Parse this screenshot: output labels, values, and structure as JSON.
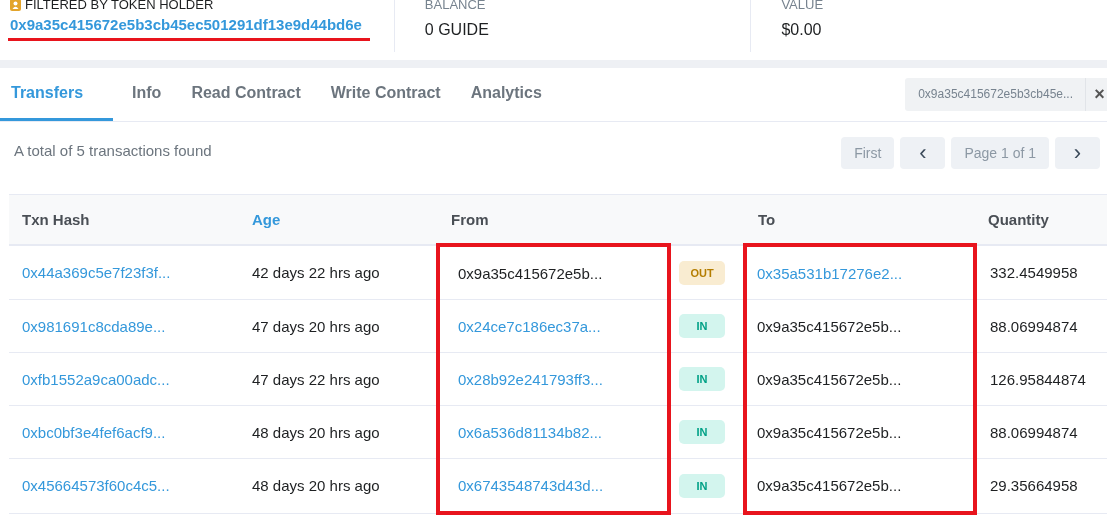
{
  "holder": {
    "label": "FILTERED BY TOKEN HOLDER",
    "address": "0x9a35c415672e5b3cb45ec501291df13e9d44bd6e",
    "underlined": true
  },
  "stats": [
    {
      "label": "BALANCE",
      "value": "0 GUIDE"
    },
    {
      "label": "VALUE",
      "value": "$0.00"
    }
  ],
  "tabs": [
    {
      "label": "Transfers",
      "selected": true
    },
    {
      "label": "Info",
      "selected": false
    },
    {
      "label": "Read Contract",
      "selected": false
    },
    {
      "label": "Write Contract",
      "selected": false
    },
    {
      "label": "Analytics",
      "selected": false
    }
  ],
  "filter_chip": {
    "value": "0x9a35c415672e5b3cb45e...",
    "close": "×"
  },
  "summary": "A total of 5 transactions found",
  "pagination": {
    "first": "First",
    "prev": "‹",
    "page": "Page 1 of 1",
    "next": "›"
  },
  "table": {
    "columns": [
      {
        "label": "Txn Hash",
        "sortable": false,
        "highlighted": false
      },
      {
        "label": "Age",
        "sortable": true,
        "highlighted": false
      },
      {
        "label": "From",
        "sortable": false,
        "highlighted": true
      },
      {
        "label": "To",
        "sortable": false,
        "highlighted": true
      },
      {
        "label": "Quantity",
        "sortable": false,
        "highlighted": false
      }
    ],
    "rows": [
      {
        "hash": "0x44a369c5e7f23f3f...",
        "age": "42 days 22 hrs ago",
        "from": "0x9a35c415672e5b...",
        "from_link": false,
        "direction": "OUT",
        "to": "0x35a531b17276e2...",
        "to_link": true,
        "quantity": "332.4549958"
      },
      {
        "hash": "0x981691c8cda89e...",
        "age": "47 days 20 hrs ago",
        "from": "0x24ce7c186ec37a...",
        "from_link": true,
        "direction": "IN",
        "to": "0x9a35c415672e5b...",
        "to_link": false,
        "quantity": "88.06994874"
      },
      {
        "hash": "0xfb1552a9ca00adc...",
        "age": "47 days 22 hrs ago",
        "from": "0x28b92e241793ff3...",
        "from_link": true,
        "direction": "IN",
        "to": "0x9a35c415672e5b...",
        "to_link": false,
        "quantity": "126.95844874"
      },
      {
        "hash": "0xbc0bf3e4fef6acf9...",
        "age": "48 days 20 hrs ago",
        "from": "0x6a536d81134b82...",
        "from_link": true,
        "direction": "IN",
        "to": "0x9a35c415672e5b...",
        "to_link": false,
        "quantity": "88.06994874"
      },
      {
        "hash": "0x45664573f60c4c5...",
        "age": "48 days 20 hrs ago",
        "from": "0x6743548743d43d...",
        "from_link": true,
        "direction": "IN",
        "to": "0x9a35c415672e5b...",
        "to_link": false,
        "quantity": "29.35664958"
      }
    ]
  }
}
